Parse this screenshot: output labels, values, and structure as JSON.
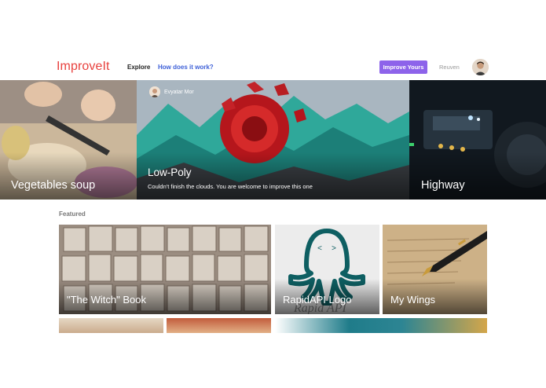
{
  "nav": {
    "logo": "ImproveIt",
    "links": [
      "Explore",
      "How does it work?"
    ],
    "cta": "Improve Yours",
    "user": "Reuven"
  },
  "hero": {
    "slides": [
      {
        "title": "Vegetables soup"
      },
      {
        "title": "Low-Poly",
        "author": "Evyatar Mor",
        "description": "Couldn't finish the clouds. You are welcome to improve this one"
      },
      {
        "title": "Highway"
      }
    ]
  },
  "featured": {
    "label": "Featured",
    "cards": [
      {
        "title": "\"The Witch\" Book"
      },
      {
        "title": "RapidAPI Logo",
        "watermark": "Rapid API"
      },
      {
        "title": "My Wings"
      }
    ]
  },
  "colors": {
    "brand": "#e8413e",
    "link": "#3f61d8",
    "cta": "#8d63ea"
  }
}
